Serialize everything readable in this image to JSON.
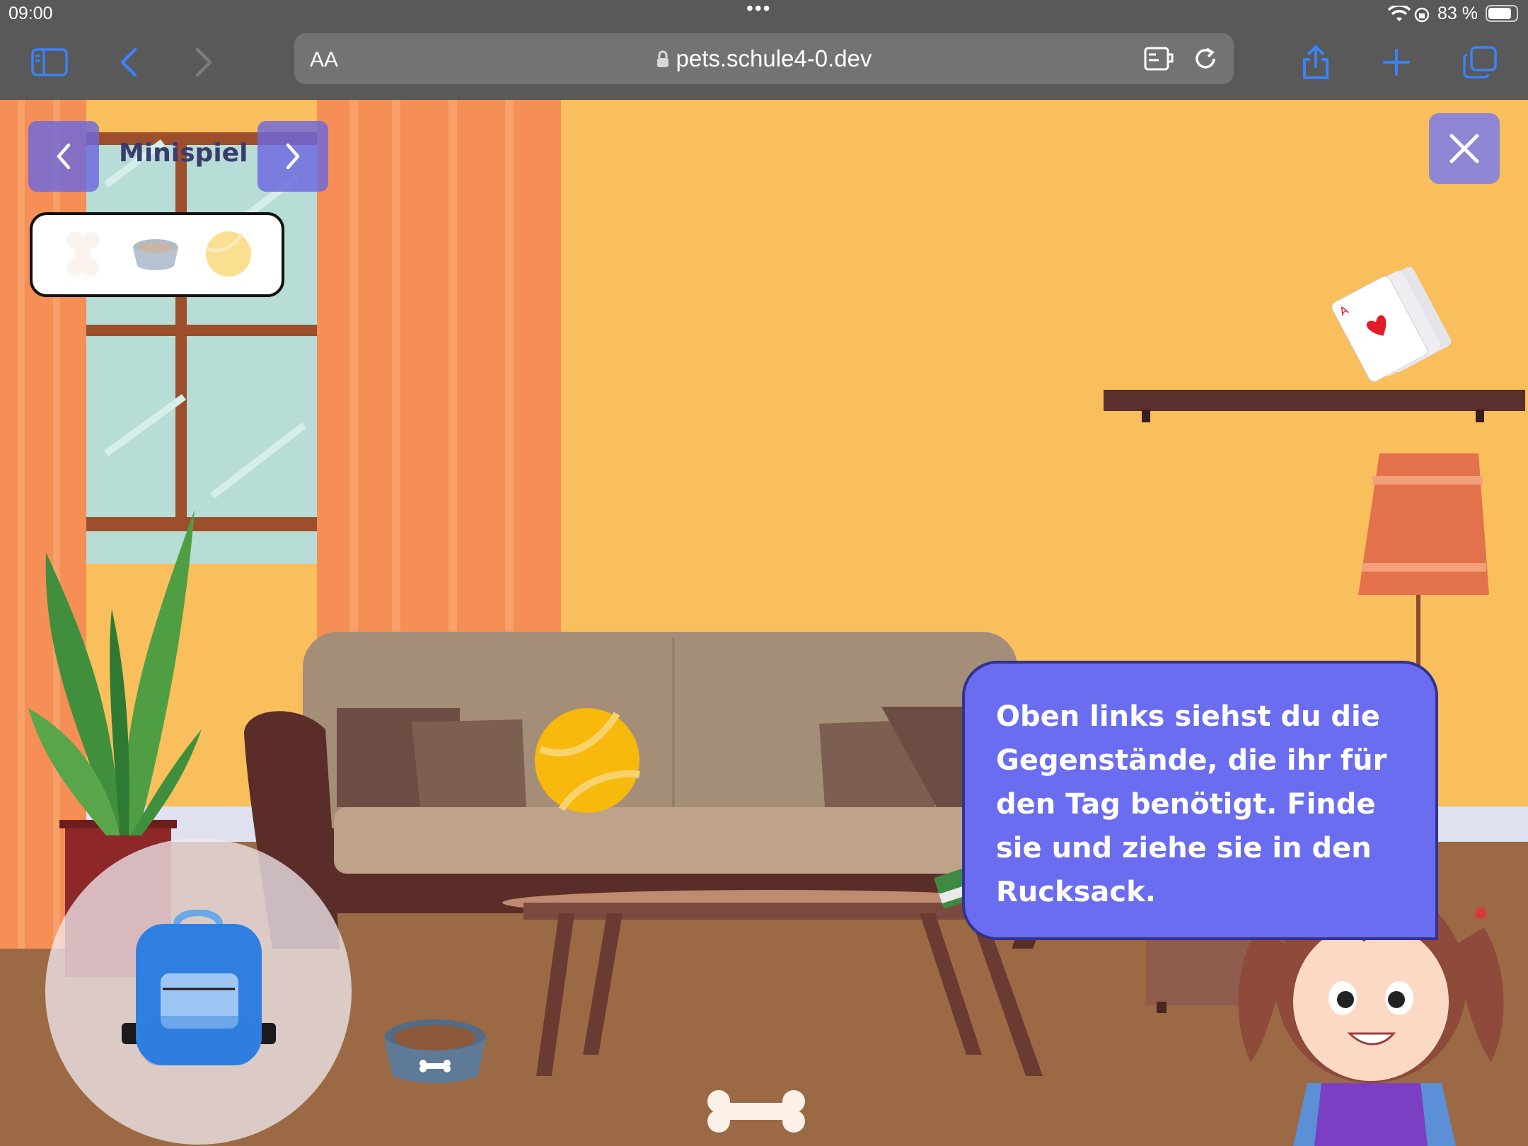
{
  "status_bar": {
    "time": "09:00",
    "dots": "•••",
    "battery_percent": "83 %",
    "battery_level": 0.83
  },
  "browser": {
    "text_size_label": "AA",
    "url": "pets.schule4-0.dev",
    "icons": [
      "sidebar-icon",
      "back-icon",
      "forward-icon",
      "lock-icon",
      "extension-icon",
      "reload-icon",
      "share-icon",
      "new-tab-icon",
      "tabs-icon"
    ]
  },
  "game": {
    "title": "Minispiel",
    "prev_icon": "chevron-left-icon",
    "next_icon": "chevron-right-icon",
    "close_icon": "close-icon",
    "needed_items": [
      "bone",
      "food-bowl",
      "tennis-ball"
    ],
    "speech_text": "Oben links siehst du die Gegenstände, die ihr für den Tag benötigt. Finde sie und ziehe sie in den Rucksack.",
    "colors": {
      "wall": "#f9bf5c",
      "curtain": "#f58f55",
      "floor": "#9b6a44",
      "speech_bubble": "#6a6df0",
      "nav_button": "#6c68de"
    }
  }
}
